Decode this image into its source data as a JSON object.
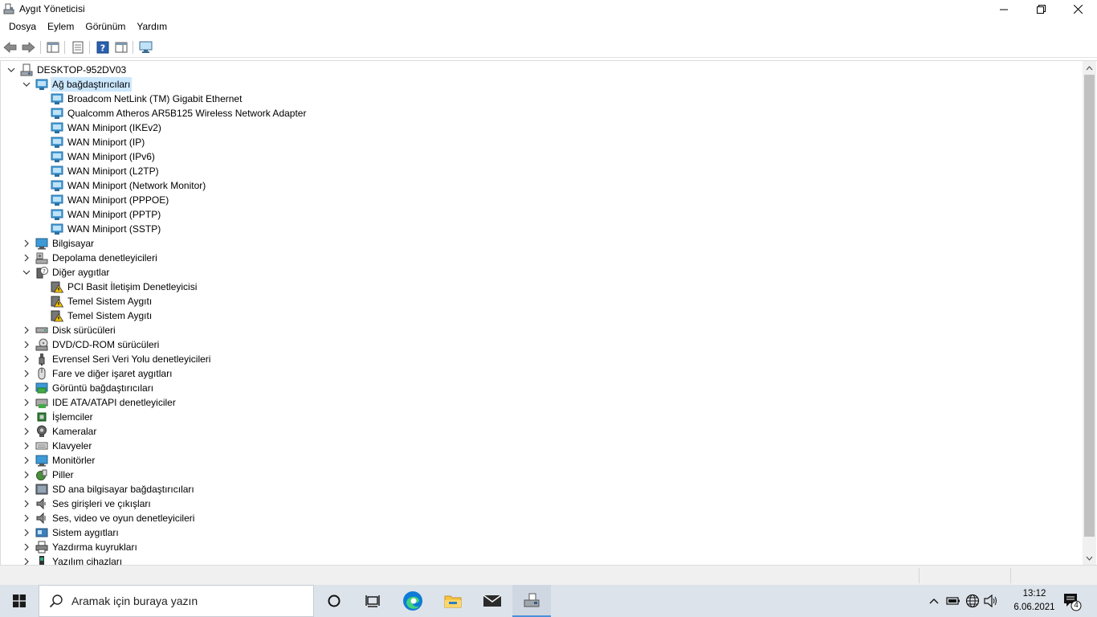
{
  "window": {
    "title": "Aygıt Yöneticisi"
  },
  "menu": {
    "items": [
      "Dosya",
      "Eylem",
      "Görünüm",
      "Yardım"
    ]
  },
  "tree": {
    "root": "DESKTOP-952DV03",
    "network": {
      "label": "Ağ bağdaştırıcıları",
      "children": [
        "Broadcom NetLink (TM) Gigabit Ethernet",
        "Qualcomm Atheros AR5B125 Wireless Network Adapter",
        "WAN Miniport (IKEv2)",
        "WAN Miniport (IP)",
        "WAN Miniport (IPv6)",
        "WAN Miniport (L2TP)",
        "WAN Miniport (Network Monitor)",
        "WAN Miniport (PPPOE)",
        "WAN Miniport (PPTP)",
        "WAN Miniport (SSTP)"
      ]
    },
    "computer": "Bilgisayar",
    "storage": "Depolama denetleyicileri",
    "other": {
      "label": "Diğer aygıtlar",
      "children": [
        "PCI Basit İletişim Denetleyicisi",
        "Temel Sistem Aygıtı",
        "Temel Sistem Aygıtı"
      ]
    },
    "categories": [
      "Disk sürücüleri",
      "DVD/CD-ROM sürücüleri",
      "Evrensel Seri Veri Yolu denetleyicileri",
      "Fare ve diğer işaret aygıtları",
      "Görüntü bağdaştırıcıları",
      "IDE ATA/ATAPI denetleyiciler",
      "İşlemciler",
      "Kameralar",
      "Klavyeler",
      "Monitörler",
      "Piller",
      "SD ana bilgisayar bağdaştırıcıları",
      "Ses girişleri ve çıkışları",
      "Ses, video ve oyun denetleyicileri",
      "Sistem aygıtları",
      "Yazdırma kuyrukları",
      "Yazılım cihazları"
    ]
  },
  "taskbar": {
    "search_placeholder": "Aramak için buraya yazın",
    "time": "13:12",
    "date": "6.06.2021",
    "notification_count": "4"
  },
  "colors": {
    "selection": "#cce8ff",
    "taskbar": "#dde3ea",
    "accent": "#4a90d9"
  }
}
